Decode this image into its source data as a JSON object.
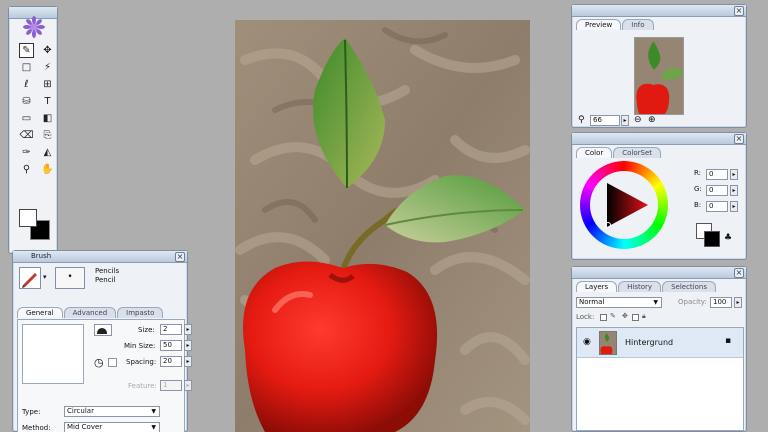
{
  "tools": {
    "icons": [
      "brush-icon",
      "move-icon",
      "rect-select-icon",
      "magic-wand-icon",
      "lasso-icon",
      "crop-icon",
      "stamp-icon",
      "text-icon",
      "rectangle-shape-icon",
      "gradient-icon",
      "eraser-icon",
      "clone-icon",
      "eyedropper-icon",
      "fill-icon",
      "zoom-icon",
      "hand-icon"
    ],
    "glyphs": [
      "✎",
      "✥",
      "□",
      "⚡",
      "ℓ",
      "⊞",
      "⛁",
      "T",
      "▭",
      "◧",
      "⌫",
      "⎘",
      "✑",
      "◭",
      "⚲",
      "✋"
    ],
    "foreground_color": "#ffffff",
    "background_color": "#000000"
  },
  "brush": {
    "title": "Brush",
    "category": "Pencils",
    "variant": "Pencil",
    "tabs": [
      "General",
      "Advanced",
      "Impasto"
    ],
    "size_label": "Size:",
    "size_value": "2",
    "min_size_label": "Min Size:",
    "min_size_value": "50",
    "spacing_label": "Spacing:",
    "spacing_value": "20",
    "feature_label": "Feature:",
    "feature_value": "1",
    "type_label": "Type:",
    "type_value": "Circular",
    "method_label": "Method:",
    "method_value": "Mid Cover"
  },
  "preview": {
    "tabs": [
      "Preview",
      "Info"
    ],
    "zoom_value": "66"
  },
  "color": {
    "tabs": [
      "Color",
      "ColorSet"
    ],
    "r_label": "R:",
    "r_value": "0",
    "g_label": "G:",
    "g_value": "0",
    "b_label": "B:",
    "b_value": "0",
    "selected_color": "#000000"
  },
  "layers": {
    "tabs": [
      "Layers",
      "History",
      "Selections"
    ],
    "blend_mode": "Normal",
    "opacity_label": "Opacity:",
    "opacity_value": "100",
    "lock_label": "Lock:",
    "layer_name": "Hintergrund"
  },
  "accent": "#7e8ea4"
}
